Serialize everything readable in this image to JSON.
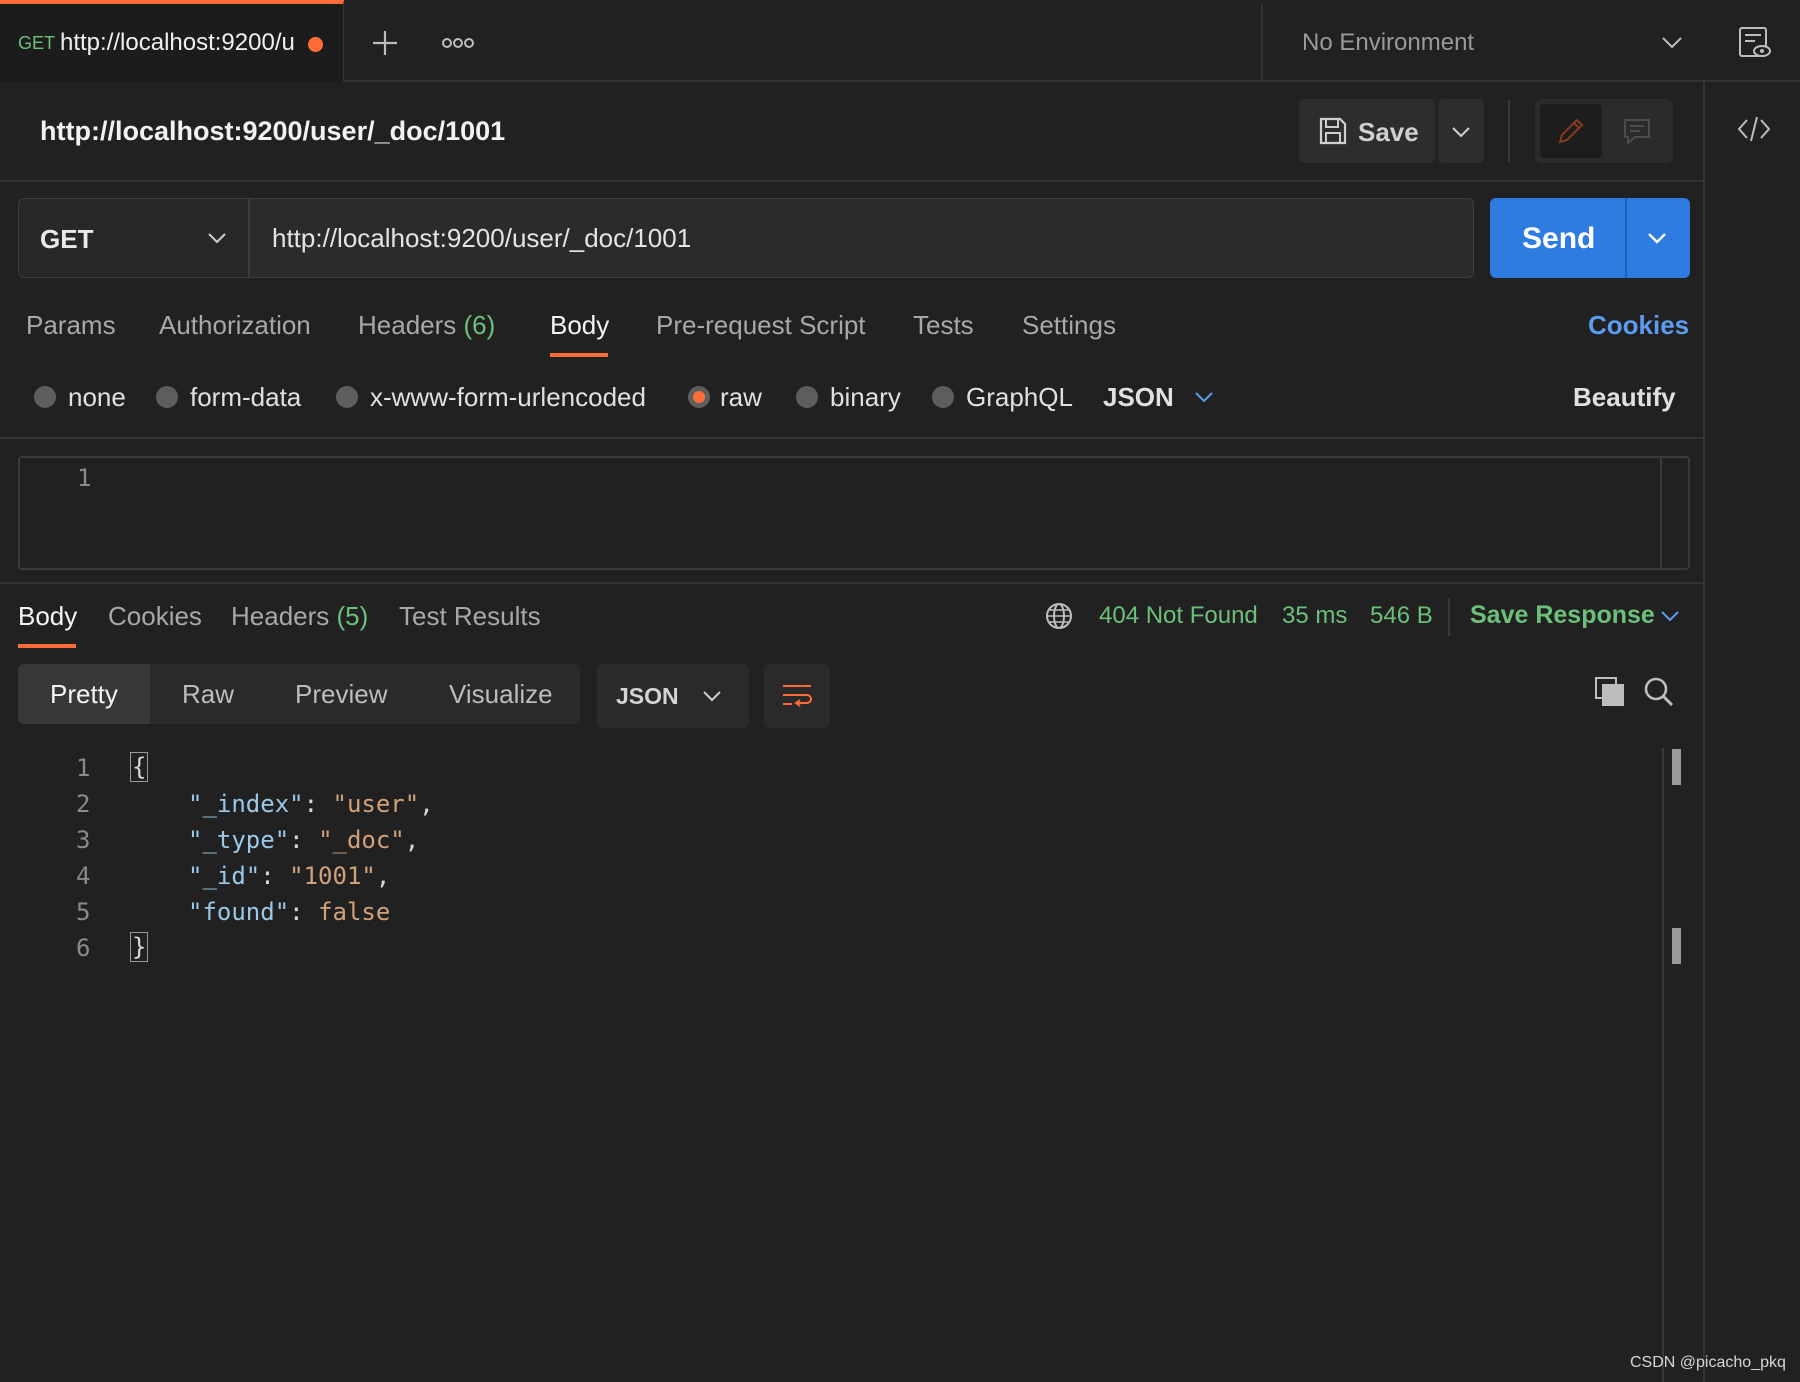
{
  "tabbar": {
    "tab": {
      "method": "GET",
      "title": "http://localhost:9200/u"
    },
    "environment": "No Environment"
  },
  "request": {
    "title": "http://localhost:9200/user/_doc/1001",
    "save_label": "Save",
    "method": "GET",
    "url": "http://localhost:9200/user/_doc/1001",
    "send_label": "Send"
  },
  "request_tabs": [
    {
      "label": "Params"
    },
    {
      "label": "Authorization"
    },
    {
      "label": "Headers",
      "count": "(6)"
    },
    {
      "label": "Body",
      "active": true
    },
    {
      "label": "Pre-request Script"
    },
    {
      "label": "Tests"
    },
    {
      "label": "Settings"
    }
  ],
  "cookies_label": "Cookies",
  "body_types": [
    {
      "label": "none",
      "selected": false
    },
    {
      "label": "form-data",
      "selected": false
    },
    {
      "label": "x-www-form-urlencoded",
      "selected": false
    },
    {
      "label": "raw",
      "selected": true
    },
    {
      "label": "binary",
      "selected": false
    },
    {
      "label": "GraphQL",
      "selected": false
    }
  ],
  "raw_format": "JSON",
  "beautify_label": "Beautify",
  "request_editor": {
    "line_numbers": [
      "1"
    ]
  },
  "response": {
    "tabs": [
      {
        "label": "Body",
        "active": true
      },
      {
        "label": "Cookies"
      },
      {
        "label": "Headers",
        "count": "(5)"
      },
      {
        "label": "Test Results"
      }
    ],
    "status": "404 Not Found",
    "time": "35 ms",
    "size": "546 B",
    "save_response_label": "Save Response",
    "views": [
      "Pretty",
      "Raw",
      "Preview",
      "Visualize"
    ],
    "format": "JSON",
    "line_numbers": [
      "1",
      "2",
      "3",
      "4",
      "5",
      "6"
    ],
    "code": {
      "open": "{",
      "close": "}",
      "lines": [
        {
          "key": "\"_index\"",
          "value": "\"user\"",
          "trail": ","
        },
        {
          "key": "\"_type\"",
          "value": "\"_doc\"",
          "trail": ","
        },
        {
          "key": "\"_id\"",
          "value": "\"1001\"",
          "trail": ","
        },
        {
          "key": "\"found\"",
          "value": "false",
          "trail": ""
        }
      ]
    }
  },
  "footer": "CSDN @picacho_pkq",
  "colors": {
    "accent": "#ff6c37",
    "send": "#2f7ce0",
    "link": "#5b9cf0",
    "status": "#6cc07a"
  }
}
